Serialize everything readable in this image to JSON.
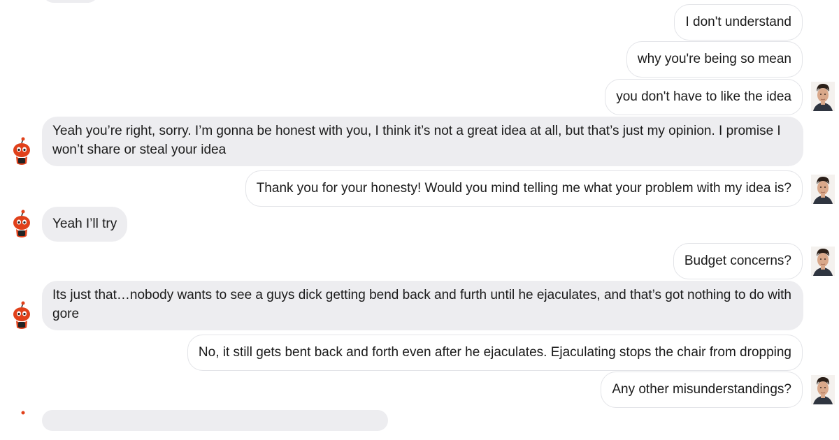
{
  "messages": [
    {
      "sender": "bot",
      "text": ""
    },
    {
      "sender": "user",
      "text": "I don't understand"
    },
    {
      "sender": "user",
      "text": "why you're being so mean"
    },
    {
      "sender": "user",
      "text": "you don't have to like the idea"
    },
    {
      "sender": "bot",
      "text": "Yeah you’re right, sorry. I’m gonna be honest with you, I think it’s not a great idea at all, but that’s just my opinion. I promise I won’t share or steal your idea"
    },
    {
      "sender": "user",
      "text": "Thank you for your honesty! Would you mind telling me what your problem with my idea is?"
    },
    {
      "sender": "bot",
      "text": "Yeah I’ll try"
    },
    {
      "sender": "user",
      "text": "Budget concerns?"
    },
    {
      "sender": "bot",
      "text": "Its just that…nobody wants to see a guys dick getting bend back and furth until he ejaculates, and that’s got nothing to do with gore"
    },
    {
      "sender": "user",
      "text": "No, it still gets bent back and forth even after he ejaculates. Ejaculating stops the chair from dropping"
    },
    {
      "sender": "user",
      "text": "Any other misunderstandings?"
    },
    {
      "sender": "bot",
      "text": ""
    }
  ],
  "icons": {
    "user_avatar": "man-portrait-avatar",
    "bot_avatar": "red-robot-mascot-avatar"
  },
  "colors": {
    "bot_bubble": "#ededf0",
    "user_bubble_border": "#e3e4e8",
    "bot_avatar": "#e0401a"
  }
}
